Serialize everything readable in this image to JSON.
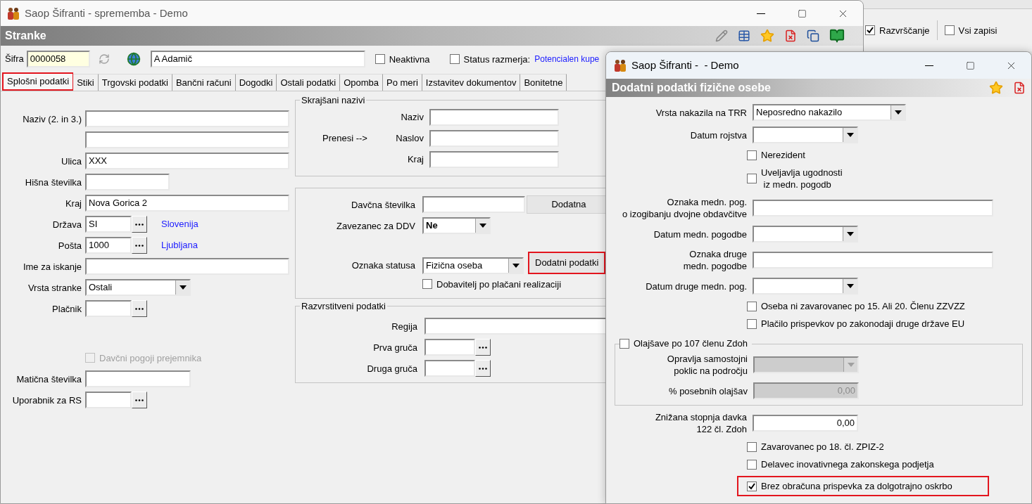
{
  "background_app": {
    "toolbar": [
      {
        "label": "Razvrščanje",
        "checked": true
      },
      {
        "label": "Vsi zapisi",
        "checked": false
      }
    ]
  },
  "main_window": {
    "title": "Saop Šifranti - sprememba - Demo",
    "header": "Stranke",
    "code": {
      "label": "Šifra",
      "value": "0000058"
    },
    "name_value": "A Adamič",
    "checks": [
      {
        "label": "Neaktivna",
        "checked": false
      },
      {
        "label": "Status razmerja:",
        "checked": false
      }
    ],
    "status_value": "Potencialen kupe",
    "tabs": [
      {
        "label": "Splošni podatki",
        "selected": true,
        "highlighted": true
      },
      {
        "label": "Stiki",
        "selected": false,
        "highlighted": false
      },
      {
        "label": "Trgovski podatki",
        "selected": false,
        "highlighted": false
      },
      {
        "label": "Bančni računi",
        "selected": false,
        "highlighted": false
      },
      {
        "label": "Dogodki",
        "selected": false,
        "highlighted": false
      },
      {
        "label": "Ostali podatki",
        "selected": false,
        "highlighted": false
      },
      {
        "label": "Opomba",
        "selected": false,
        "highlighted": false
      },
      {
        "label": "Po meri",
        "selected": false,
        "highlighted": false
      },
      {
        "label": "Izstavitev dokumentov",
        "selected": false,
        "highlighted": false
      },
      {
        "label": "Bonitetne",
        "selected": false,
        "highlighted": false
      }
    ],
    "left_fields": [
      {
        "kind": "wide",
        "label": "Naziv (2. in 3.)"
      },
      {
        "kind": "wide"
      },
      {
        "kind": "wide",
        "label": "Ulica",
        "value": "XXX"
      },
      {
        "kind": "short",
        "label": "Hišna številka"
      },
      {
        "kind": "wide",
        "label": "Kraj",
        "value": "Nova Gorica 2"
      },
      {
        "kind": "lookup",
        "label": "Država",
        "value": "SI",
        "link": "Slovenija"
      },
      {
        "kind": "lookup",
        "label": "Pošta",
        "value": "1000",
        "link": "Ljubljana"
      },
      {
        "kind": "wide",
        "label": "Ime za iskanje"
      },
      {
        "kind": "dropdown",
        "label": "Vrsta stranke",
        "value": "Ostali"
      },
      {
        "kind": "lookup",
        "label": "Plačnik"
      },
      {
        "kind": "checkbox",
        "label": "Davčni pogoji prejemnika",
        "checked": false,
        "disabled": true
      },
      {
        "kind": "medium",
        "label": "Matična številka"
      },
      {
        "kind": "lookup",
        "label": "Uporabnik za RS"
      }
    ],
    "short_names": {
      "title": "Skrajšani nazivi",
      "transfer_label": "Prenesi -->",
      "fields": [
        {
          "label": "Naziv"
        },
        {
          "label": "Naslov"
        },
        {
          "label": "Kraj"
        }
      ]
    },
    "tax_group": {
      "tax_number_label": "Davčna številka",
      "extra_button": "Dodatna",
      "vat": {
        "label": "Zavezanec za DDV",
        "value": "Ne"
      },
      "status": {
        "label": "Oznaka statusa",
        "value": "Fizična oseba"
      },
      "details_button": {
        "label": "Dodatni podatki",
        "highlighted": true
      },
      "supplier_check": {
        "label": "Dobavitelj po plačani realizaciji",
        "checked": false
      }
    },
    "classification": {
      "title": "Razvrstitveni podatki",
      "fields": [
        {
          "kind": "wide",
          "label": "Regija"
        },
        {
          "kind": "lookup",
          "label": "Prva gruča"
        },
        {
          "kind": "lookup",
          "label": "Druga gruča"
        }
      ]
    }
  },
  "dialog": {
    "title": "Saop Šifranti -  - Demo",
    "header": "Dodatni podatki fizične osebe",
    "rows": [
      {
        "kind": "choice",
        "label": "Vrsta nakazila na TRR",
        "value": "Neposredno nakazilo"
      },
      {
        "kind": "dropdown",
        "label": "Datum rojstva"
      },
      {
        "kind": "checkbox",
        "label": "Nerezident",
        "checked": false,
        "highlighted": false
      },
      {
        "kind": "checkbox",
        "label": "Uveljavlja ugodnosti\n iz medn. pogodb",
        "checked": false,
        "highlighted": false
      },
      {
        "kind": "text",
        "label": "Oznaka medn. pog.\no izogibanju dvojne obdavčitve"
      },
      {
        "kind": "dropdown",
        "label": "Datum medn. pogodbe"
      },
      {
        "kind": "text",
        "label": "Oznaka druge\nmedn. pogodbe"
      },
      {
        "kind": "dropdown",
        "label": "Datum druge medn. pog."
      },
      {
        "kind": "checkbox",
        "label": "Oseba ni zavarovanec po 15. Ali 20. Členu ZZVZZ",
        "checked": false,
        "highlighted": false
      },
      {
        "kind": "checkbox",
        "label": "Plačilo prispevkov po zakonodaji druge države EU",
        "checked": false,
        "highlighted": false
      },
      {
        "kind": "group",
        "label": "Olajšave po 107 členu Zdoh",
        "checked": false,
        "rows": [
          {
            "kind": "dropdown",
            "label": "Opravlja samostojni\npoklic na področju",
            "disabled": true
          },
          {
            "kind": "number",
            "label": "% posebnih olajšav",
            "value": "0,00",
            "disabled": true
          }
        ]
      },
      {
        "kind": "number",
        "label": "Znižana stopnja davka\n122 čl. Zdoh",
        "value": "0,00"
      },
      {
        "kind": "checkbox",
        "label": "Zavarovanec po 18. čl. ZPIZ-2",
        "checked": false,
        "highlighted": false
      },
      {
        "kind": "checkbox",
        "label": "Delavec inovativnega zakonskega podjetja",
        "checked": false,
        "highlighted": false
      },
      {
        "kind": "checkbox",
        "label": "Brez obračuna prispevka za dolgotrajno oskrbo",
        "checked": true,
        "highlighted": true
      }
    ]
  }
}
